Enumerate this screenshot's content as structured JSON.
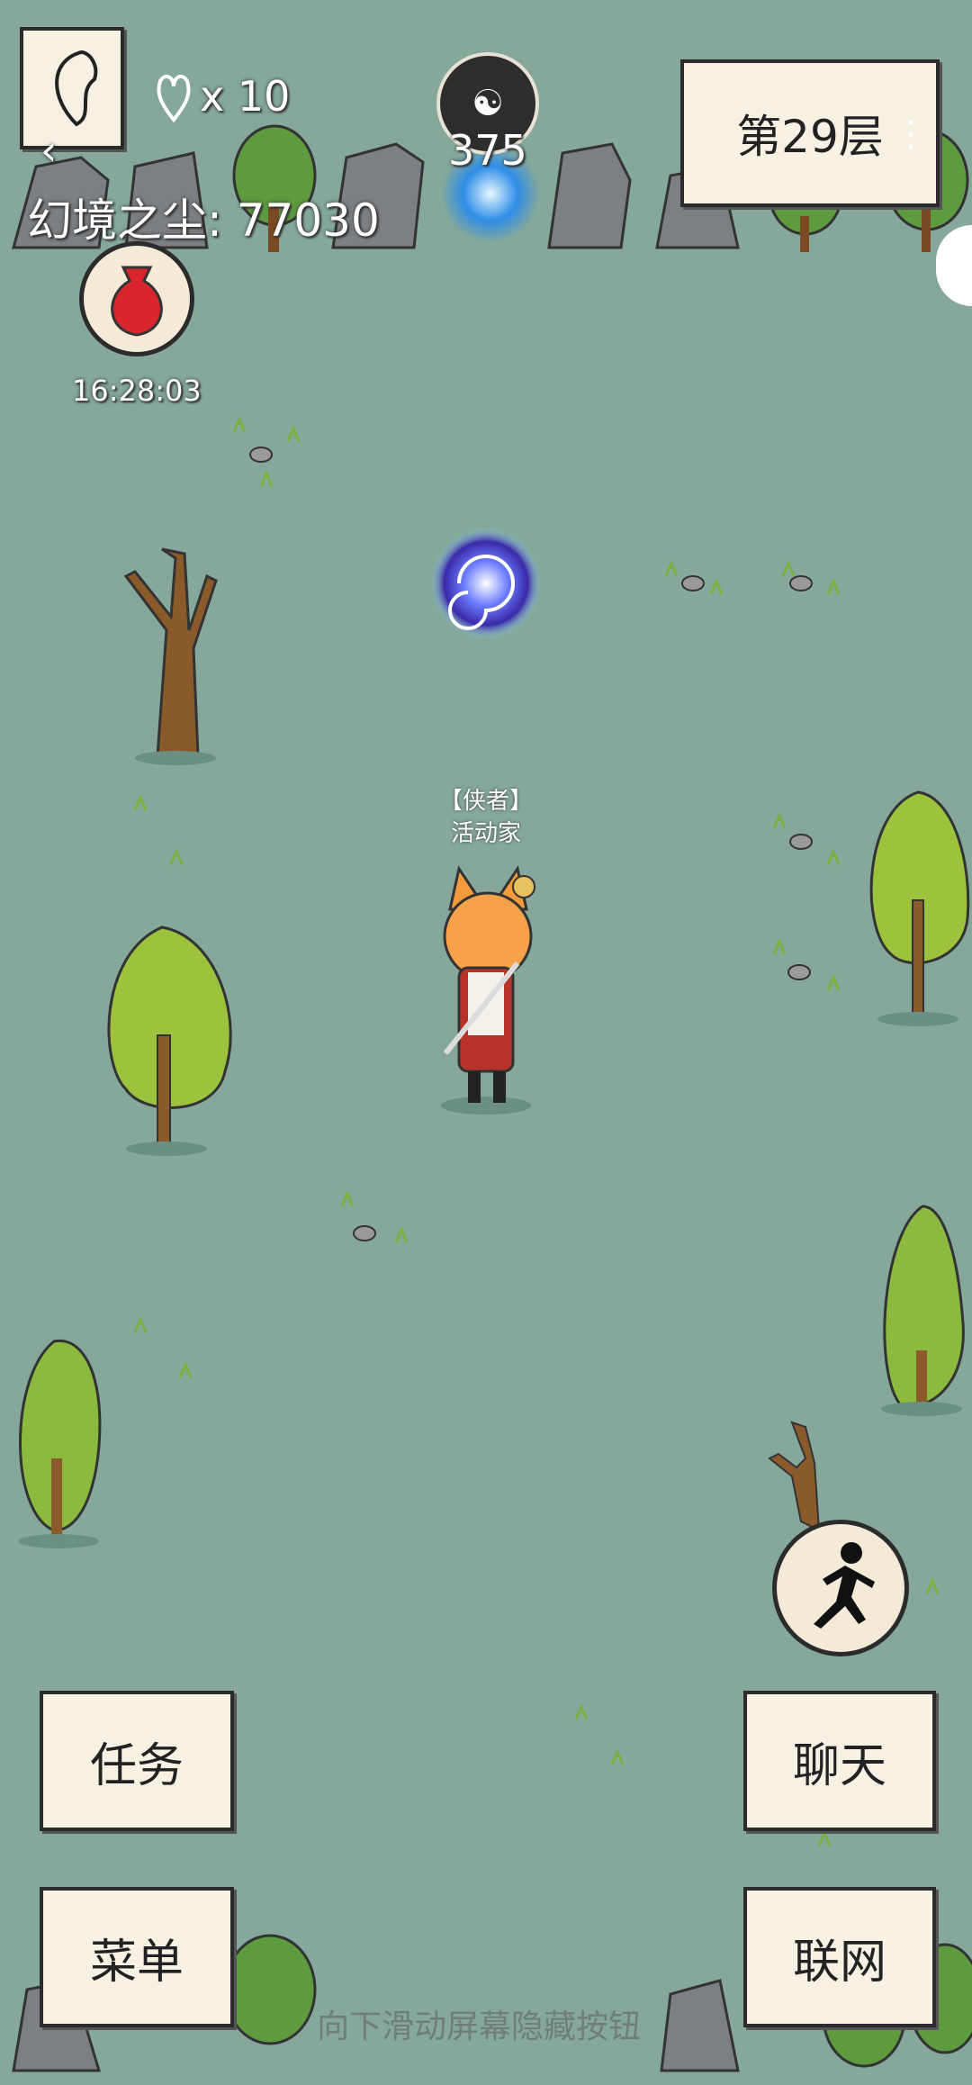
{
  "hud": {
    "lives_label": "x 10",
    "dust_label": "幻境之尘: 77030",
    "timer": "16:28:03",
    "token_count": "375",
    "floor_label": "第29层"
  },
  "player": {
    "title": "【侠者】",
    "name": "活动家"
  },
  "buttons": {
    "task": "任务",
    "chat": "聊天",
    "menu": "菜单",
    "network": "联网"
  },
  "hint": "向下滑动屏幕隐藏按钮",
  "colors": {
    "ground": "#85a89a",
    "paper": "#f6f1e3"
  },
  "icons": [
    "back-icon",
    "heart-icon",
    "loot-bag-icon",
    "coin-token-icon",
    "portal-icon",
    "sprint-icon",
    "more-options-icon"
  ]
}
